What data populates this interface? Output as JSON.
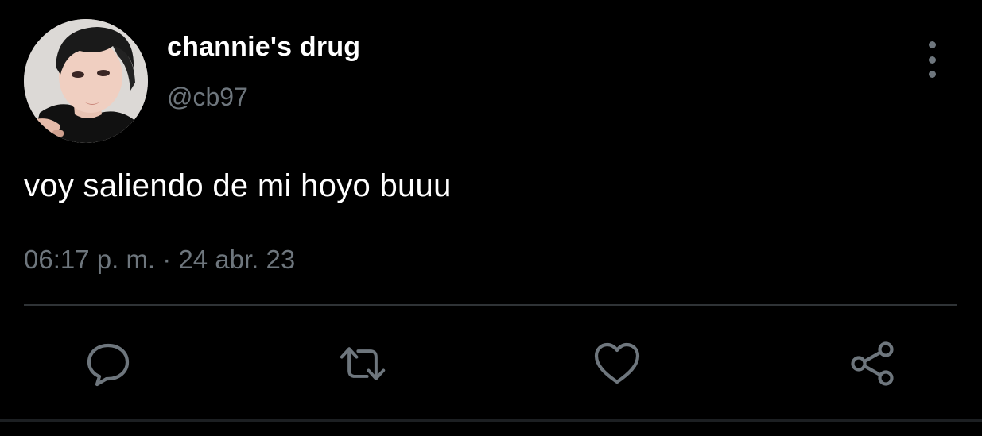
{
  "tweet": {
    "display_name": "channie's drug",
    "handle": "@cb97",
    "text": "voy saliendo de mi hoyo buuu",
    "timestamp": "06:17 p. m. · 24 abr. 23"
  },
  "header": {
    "avatar": "profile-photo",
    "more_icon": "vertical-ellipsis-icon"
  },
  "actions": [
    {
      "icon": "reply-icon"
    },
    {
      "icon": "retweet-icon"
    },
    {
      "icon": "like-icon"
    },
    {
      "icon": "share-icon"
    }
  ],
  "colors": {
    "background": "#000000",
    "primary_text": "#ffffff",
    "secondary_text": "#6e767d",
    "divider": "#2f3336",
    "icon": "#6e767d"
  }
}
